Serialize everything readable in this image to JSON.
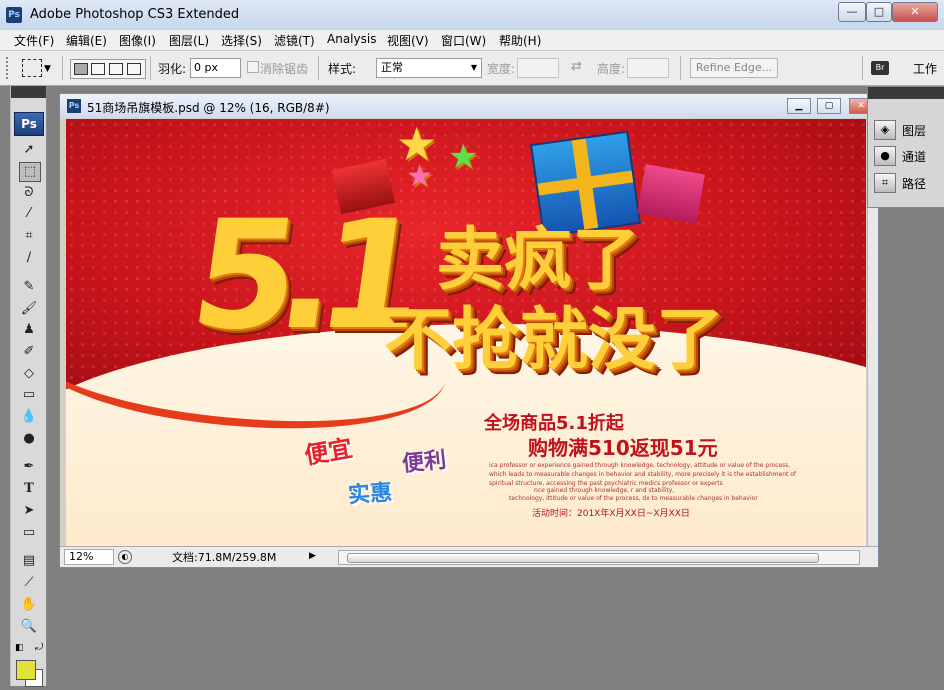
{
  "window": {
    "title": "Adobe Photoshop CS3 Extended",
    "app_icon": "Ps",
    "controls": [
      "—",
      "□",
      "✕"
    ]
  },
  "menu": [
    "文件(F)",
    "编辑(E)",
    "图像(I)",
    "图层(L)",
    "选择(S)",
    "滤镜(T)",
    "Analysis",
    "视图(V)",
    "窗口(W)",
    "帮助(H)"
  ],
  "options": {
    "feather_label": "羽化:",
    "feather_value": "0 px",
    "antialias_label": "消除锯齿",
    "style_label": "样式:",
    "style_value": "正常",
    "width_label": "宽度:",
    "height_label": "高度:",
    "refine_edge": "Refine Edge...",
    "workspace": "工作"
  },
  "tools": {
    "logo": "Ps"
  },
  "document": {
    "title": "51商场吊旗模板.psd @ 12% (16, RGB/8#)",
    "icon": "Ps",
    "zoom": "12%",
    "doc_size": "文档:71.8M/259.8M"
  },
  "panels": [
    {
      "label": "图层",
      "icon": "layers-icon"
    },
    {
      "label": "通道",
      "icon": "channels-icon"
    },
    {
      "label": "路径",
      "icon": "paths-icon"
    }
  ],
  "artwork": {
    "big_number": "5.1",
    "headline1": "卖疯了",
    "headline2": "不抢就没了",
    "promo1": "全场商品5.1折起",
    "promo2": "购物满510返现51元",
    "word1": "便宜",
    "word2": "便利",
    "word3": "实惠",
    "fine1": "ica professor or experience gained through knowledge, technology, attitude or value of the process.",
    "fine2": "which leads to measurable changes in behavior and stability, more precisely it is the establishment of",
    "fine3": "spiritual structure, accessing the past psychiatric medics professor or experts",
    "fine4": "nce gained through knowledge, r and stability,",
    "fine5": "technology, ittitude or value of the process, dx to measurable changes in behavior",
    "event_time": "活动时间：201X年X月XX日~X月XX日"
  },
  "colors": {
    "banner_red": "#c8141b",
    "gold": "#ffcf3a",
    "promo_text": "#c0121c",
    "fg_swatch": "#e2e03a"
  }
}
